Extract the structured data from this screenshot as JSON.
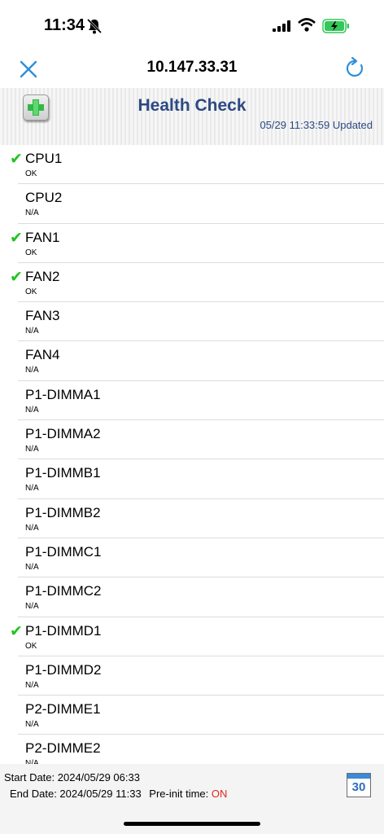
{
  "status_bar": {
    "time": "11:34",
    "bell_icon": "bell-slash-icon"
  },
  "nav": {
    "title": "10.147.33.31",
    "close_icon": "close-icon",
    "refresh_icon": "refresh-icon"
  },
  "header": {
    "title": "Health Check",
    "updated": "05/29 11:33:59 Updated"
  },
  "items": [
    {
      "name": "CPU1",
      "status": "OK",
      "checked": true
    },
    {
      "name": "CPU2",
      "status": "N/A",
      "checked": false
    },
    {
      "name": "FAN1",
      "status": "OK",
      "checked": true
    },
    {
      "name": "FAN2",
      "status": "OK",
      "checked": true
    },
    {
      "name": "FAN3",
      "status": "N/A",
      "checked": false
    },
    {
      "name": "FAN4",
      "status": "N/A",
      "checked": false
    },
    {
      "name": "P1-DIMMA1",
      "status": "N/A",
      "checked": false
    },
    {
      "name": "P1-DIMMA2",
      "status": "N/A",
      "checked": false
    },
    {
      "name": "P1-DIMMB1",
      "status": "N/A",
      "checked": false
    },
    {
      "name": "P1-DIMMB2",
      "status": "N/A",
      "checked": false
    },
    {
      "name": "P1-DIMMC1",
      "status": "N/A",
      "checked": false
    },
    {
      "name": "P1-DIMMC2",
      "status": "N/A",
      "checked": false
    },
    {
      "name": "P1-DIMMD1",
      "status": "OK",
      "checked": true
    },
    {
      "name": "P1-DIMMD2",
      "status": "N/A",
      "checked": false
    },
    {
      "name": "P2-DIMME1",
      "status": "N/A",
      "checked": false
    },
    {
      "name": "P2-DIMME2",
      "status": "N/A",
      "checked": false
    }
  ],
  "check_mark": "✔",
  "footer": {
    "start_date": "Start Date: 2024/05/29 06:33",
    "end_date": "End Date: 2024/05/29 11:33",
    "preinit_label": "Pre-init time:",
    "preinit_value": "ON",
    "calendar_day": "30"
  },
  "colors": {
    "accent": "#2c4a82",
    "check": "#22c322",
    "on": "#e0261a",
    "icon_blue": "#3d8ad6"
  }
}
